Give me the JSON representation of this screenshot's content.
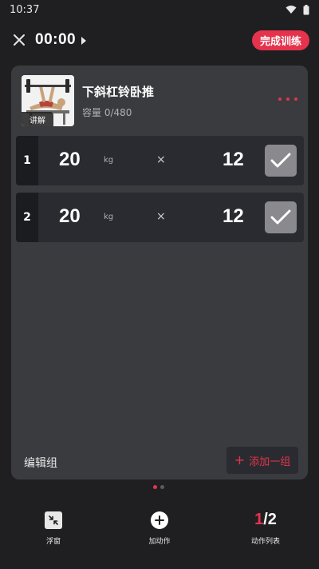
{
  "status_bar": {
    "time": "10:37"
  },
  "header": {
    "timer": "00:00",
    "finish_label": "完成训练"
  },
  "exercise": {
    "name": "下斜杠铃卧推",
    "thumb_badge": "讲解",
    "volume_label": "容量 ",
    "volume_value": "0/480"
  },
  "sets": [
    {
      "index": "1",
      "weight": "20",
      "unit": "kg",
      "times": "×",
      "reps": "12"
    },
    {
      "index": "2",
      "weight": "20",
      "unit": "kg",
      "times": "×",
      "reps": "12"
    }
  ],
  "card_footer": {
    "edit_group": "编辑组",
    "add_set": "添加一组",
    "add_set_icon": "+"
  },
  "pager": {
    "active_page": 1,
    "pages": 2
  },
  "bottom_bar": {
    "float_label": "浮窗",
    "add_exercise_label": "加动作",
    "list_current": "1",
    "list_sep": "/",
    "list_total": "2",
    "list_label": "动作列表"
  },
  "colors": {
    "accent": "#e5334d",
    "card": "#3a3b3f",
    "background": "#1f1f21"
  }
}
